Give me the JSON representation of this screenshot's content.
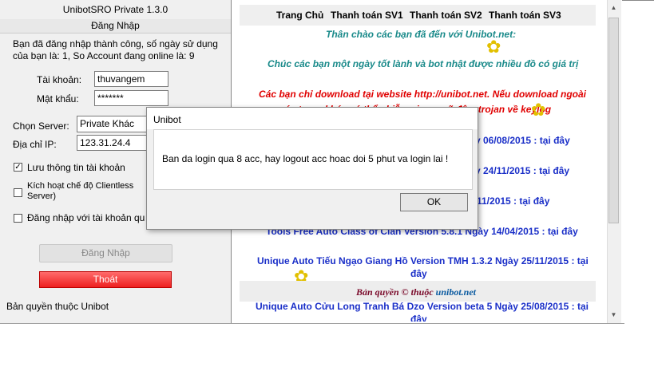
{
  "app": {
    "title": "UnibotSRO Private 1.3.0",
    "login_header": "Đăng Nhập",
    "status_line1": "Bạn đã đăng nhập thành công, số ngày sử dụng",
    "status_line2": "của bạn là: 1, So Account đang online là: 9",
    "username_label": "Tài khoản:",
    "username_value": "thuvangem",
    "password_label": "Mật khẩu:",
    "password_value": "*******",
    "server_label": "Chọn Server:",
    "server_value": "Private Khác",
    "ip_label": "Địa chỉ IP:",
    "ip_value": "123.31.24.4",
    "save_label": "Lưu thông tin tài khoản",
    "clientless_label_1": "Kích hoạt chế độ Clientless",
    "clientless_label_2": "Server)",
    "login_other_label": "Đăng nhập với tài khoản qu",
    "login_button": "Đăng Nhập",
    "logout_button": "Thoát",
    "copyright": "Bản quyền thuộc Unibot"
  },
  "web": {
    "nav": [
      "Trang Chủ",
      "Thanh toán SV1",
      "Thanh toán SV2",
      "Thanh toán SV3"
    ],
    "welcome": "Thân chào các bạn đã đến với Unibot.net:",
    "wish": "Chúc các bạn một ngày tốt lành và bot nhật được nhiều đồ có giá trị",
    "warning1": "Các bạn chỉ download tại website http://unibot.net. Nếu download ngoài",
    "warning2": "các trang khác có thể nhiễm virus, mã độc, trojan về keylog",
    "item1_tail": "y 06/08/2015 : ",
    "item2_tail": "y 24/11/2015 : ",
    "item3_tail": "11/2015 : ",
    "item4": "Tools Free Auto Class of Clan Version 5.8.1 Ngày 14/04/2015 : ",
    "item5": "Unique Auto Tiếu Ngạo Giang Hồ Version TMH 1.3.2 Ngày 25/11/2015 : tại",
    "item5_b": "đây",
    "item6": "Unique Auto Cửu Long Tranh Bá Dzo Version beta 5 Ngày 25/08/2015 : tại",
    "item6_b": "đây",
    "link": "tại đây",
    "footer_prefix": "Bản quyền © thuộc ",
    "footer_brand": "unibot.net"
  },
  "dialog": {
    "title": "Unibot",
    "message": "Ban da login qua 8 acc, hay logout acc hoac doi 5 phut va login lai !",
    "ok": "OK"
  },
  "icons": {
    "flower": "flower-icon",
    "check": "✓",
    "scroll_up": "▲",
    "scroll_down": "▼"
  }
}
